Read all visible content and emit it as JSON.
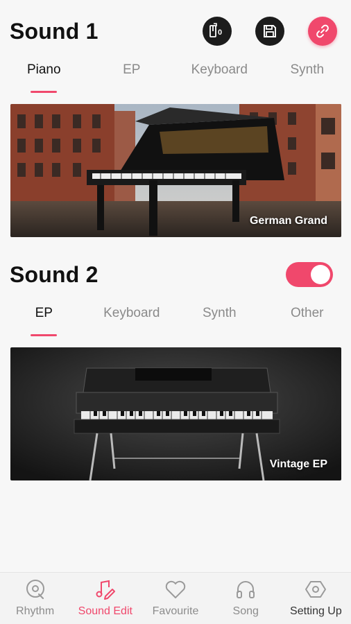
{
  "sound1": {
    "title": "Sound 1",
    "tabs": [
      {
        "label": "Piano",
        "active": true
      },
      {
        "label": "EP",
        "active": false
      },
      {
        "label": "Keyboard",
        "active": false
      },
      {
        "label": "Synth",
        "active": false
      }
    ],
    "card": {
      "label": "German Grand"
    }
  },
  "sound2": {
    "title": "Sound 2",
    "toggle_on": true,
    "tabs": [
      {
        "label": "EP",
        "active": true
      },
      {
        "label": "Keyboard",
        "active": false
      },
      {
        "label": "Synth",
        "active": false
      },
      {
        "label": "Other",
        "active": false
      }
    ],
    "card": {
      "label": "Vintage EP"
    }
  },
  "header_actions": {
    "transpose_value": "0"
  },
  "bottom_nav": [
    {
      "label": "Rhythm",
      "icon": "rhythm-icon",
      "active": false
    },
    {
      "label": "Sound Edit",
      "icon": "sound-edit-icon",
      "active": true
    },
    {
      "label": "Favourite",
      "icon": "heart-icon",
      "active": false
    },
    {
      "label": "Song",
      "icon": "headphones-icon",
      "active": false
    },
    {
      "label": "Setting Up",
      "icon": "settings-hex-icon",
      "active": false
    }
  ],
  "colors": {
    "accent": "#f0486c",
    "dark_button": "#1c1c1c",
    "background": "#f7f7f7"
  }
}
